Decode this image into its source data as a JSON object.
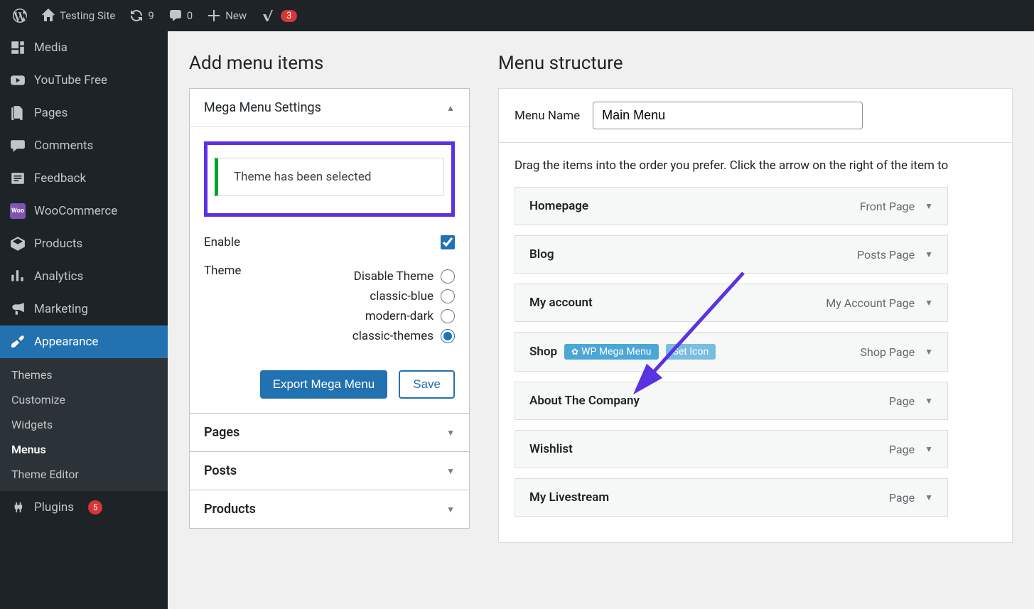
{
  "adminbar": {
    "site_name": "Testing Site",
    "updates": "9",
    "comments": "0",
    "new_label": "New",
    "yoast_count": "3"
  },
  "sidebar": {
    "items": [
      {
        "label": "Media"
      },
      {
        "label": "YouTube Free"
      },
      {
        "label": "Pages"
      },
      {
        "label": "Comments"
      },
      {
        "label": "Feedback"
      },
      {
        "label": "WooCommerce"
      },
      {
        "label": "Products"
      },
      {
        "label": "Analytics"
      },
      {
        "label": "Marketing"
      },
      {
        "label": "Appearance"
      },
      {
        "label": "Plugins",
        "badge": "5"
      }
    ],
    "appearance_sub": [
      {
        "label": "Themes"
      },
      {
        "label": "Customize"
      },
      {
        "label": "Widgets"
      },
      {
        "label": "Menus"
      },
      {
        "label": "Theme Editor"
      }
    ]
  },
  "left_col": {
    "title": "Add menu items",
    "mega_panel": {
      "title": "Mega Menu Settings",
      "notice": "Theme has been selected",
      "enable_label": "Enable",
      "theme_label": "Theme",
      "theme_options": [
        "Disable Theme",
        "classic-blue",
        "modern-dark",
        "classic-themes"
      ],
      "selected_theme": "classic-themes",
      "export_btn": "Export Mega Menu",
      "save_btn": "Save"
    },
    "other_panels": [
      "Pages",
      "Posts",
      "Products"
    ]
  },
  "right_col": {
    "title": "Menu structure",
    "menu_name_label": "Menu Name",
    "menu_name_value": "Main Menu",
    "drag_desc": "Drag the items into the order you prefer. Click the arrow on the right of the item to",
    "items": [
      {
        "title": "Homepage",
        "type": "Front Page"
      },
      {
        "title": "Blog",
        "type": "Posts Page"
      },
      {
        "title": "My account",
        "type": "My Account Page"
      },
      {
        "title": "Shop",
        "type": "Shop Page",
        "mega": true,
        "mm_label": "WP Mega Menu",
        "icon_label": "Set Icon"
      },
      {
        "title": "About The Company",
        "type": "Page"
      },
      {
        "title": "Wishlist",
        "type": "Page"
      },
      {
        "title": "My Livestream",
        "type": "Page"
      }
    ]
  }
}
